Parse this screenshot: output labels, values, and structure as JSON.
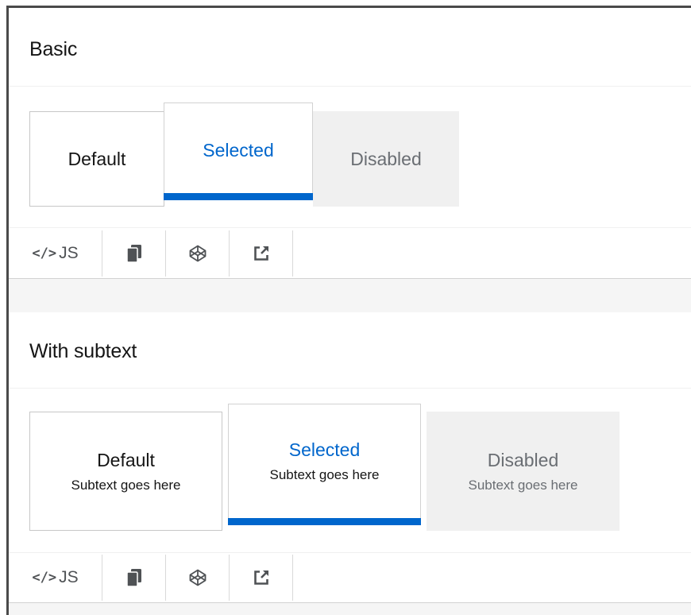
{
  "sections": [
    {
      "title": "Basic",
      "tiles": [
        {
          "label": "Default",
          "state": "default"
        },
        {
          "label": "Selected",
          "state": "selected"
        },
        {
          "label": "Disabled",
          "state": "disabled"
        }
      ],
      "toolbar": {
        "code_label": "JS",
        "code_glyph": "</>",
        "icons": [
          "copy-icon",
          "codepen-icon",
          "external-link-icon"
        ]
      }
    },
    {
      "title": "With subtext",
      "tiles": [
        {
          "label": "Default",
          "subtext": "Subtext goes here",
          "state": "default"
        },
        {
          "label": "Selected",
          "subtext": "Subtext goes here",
          "state": "selected"
        },
        {
          "label": "Disabled",
          "subtext": "Subtext goes here",
          "state": "disabled"
        }
      ],
      "toolbar": {
        "code_label": "JS",
        "code_glyph": "</>",
        "icons": [
          "copy-icon",
          "codepen-icon",
          "external-link-icon"
        ]
      }
    }
  ],
  "colors": {
    "accent": "#0066cc",
    "disabled_bg": "#f0f0f0",
    "disabled_text": "#6a6e73",
    "text": "#151515"
  }
}
